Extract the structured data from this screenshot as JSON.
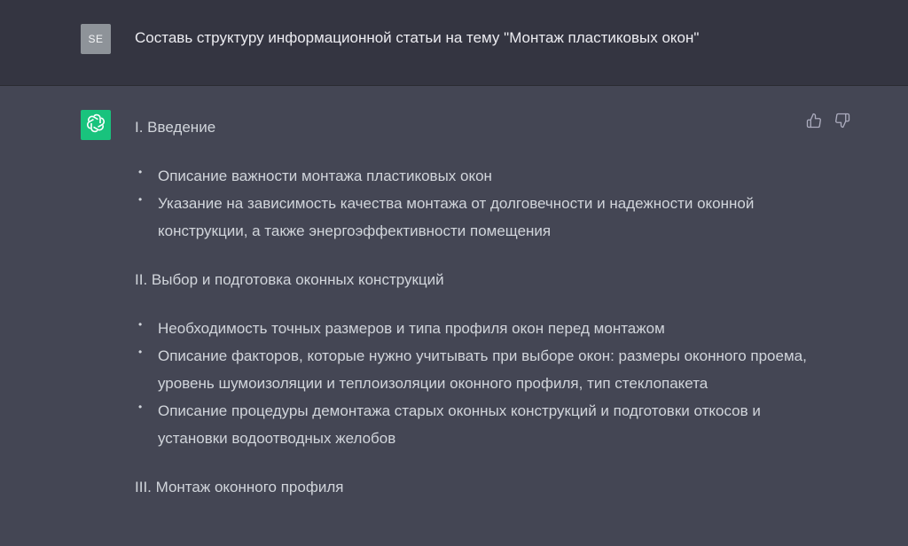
{
  "user": {
    "avatar_initials": "SE",
    "prompt": "Составь структуру информационной статьи на тему \"Монтаж пластиковых окон\""
  },
  "assistant": {
    "avatar_icon": "openai-logo-icon",
    "feedback": {
      "like_icon": "thumbs-up-icon",
      "dislike_icon": "thumbs-down-icon"
    },
    "sections": [
      {
        "heading": "I. Введение",
        "bullets": [
          "Описание важности монтажа пластиковых окон",
          "Указание на зависимость качества монтажа от долговечности и надежности оконной конструкции, а также энергоэффективности помещения"
        ]
      },
      {
        "heading": "II. Выбор и подготовка оконных конструкций",
        "bullets": [
          "Необходимость точных размеров и типа профиля окон перед монтажом",
          "Описание факторов, которые нужно учитывать при выборе окон: размеры оконного проема, уровень шумоизоляции и теплоизоляции оконного профиля, тип стеклопакета",
          "Описание процедуры демонтажа старых оконных конструкций и подготовки откосов и установки водоотводных желобов"
        ]
      },
      {
        "heading": "III. Монтаж оконного профиля",
        "bullets": []
      }
    ]
  },
  "colors": {
    "user_row_bg": "#343541",
    "assistant_row_bg": "#444654",
    "assistant_avatar_bg": "#19c37d",
    "user_avatar_bg": "#8e9399",
    "text": "#d1d5db"
  }
}
